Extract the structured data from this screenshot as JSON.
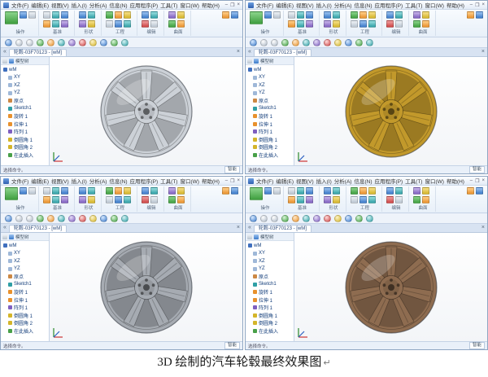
{
  "caption": {
    "text": "3D 绘制的汽车轮毂最终效果图",
    "mark": "↵"
  },
  "shared": {
    "menu": [
      "文件(F)",
      "编辑(E)",
      "视图(V)",
      "插入(I)",
      "分析(A)",
      "信息(N)",
      "应用程序(P)",
      "工具(T)",
      "窗口(W)",
      "帮助(H)"
    ],
    "window_controls": {
      "minimize": "–",
      "restore": "❐",
      "close": "×"
    },
    "ribbon_groups": [
      {
        "label": "操作"
      },
      {
        "label": "基准"
      },
      {
        "label": "形状"
      },
      {
        "label": "工程"
      },
      {
        "label": "编辑"
      },
      {
        "label": "曲面"
      }
    ],
    "tab_prefix": "«",
    "tab_close": "×",
    "tree": {
      "title": "模型树",
      "items": [
        "wM",
        "XY",
        "XZ",
        "YZ",
        "原点",
        "Sketch1",
        "旋转 1",
        "拉伸 1",
        "阵列 1",
        "倒圆角 1",
        "倒圆角 2",
        "在此插入"
      ]
    },
    "status": {
      "left": "选择命令。",
      "filter": "智能"
    }
  },
  "panels": [
    {
      "tab": "轮毂-03F70123 - [wM]",
      "wheel_color": "#ccd1d7"
    },
    {
      "tab": "轮毂-03F70123 - [wM]",
      "wheel_color": "#c2992b"
    },
    {
      "tab": "轮毂-03F70123 - [wM]",
      "wheel_color": "#a6abb2"
    },
    {
      "tab": "轮毂-03F70123 - [wM]",
      "wheel_color": "#8e6c50"
    }
  ]
}
